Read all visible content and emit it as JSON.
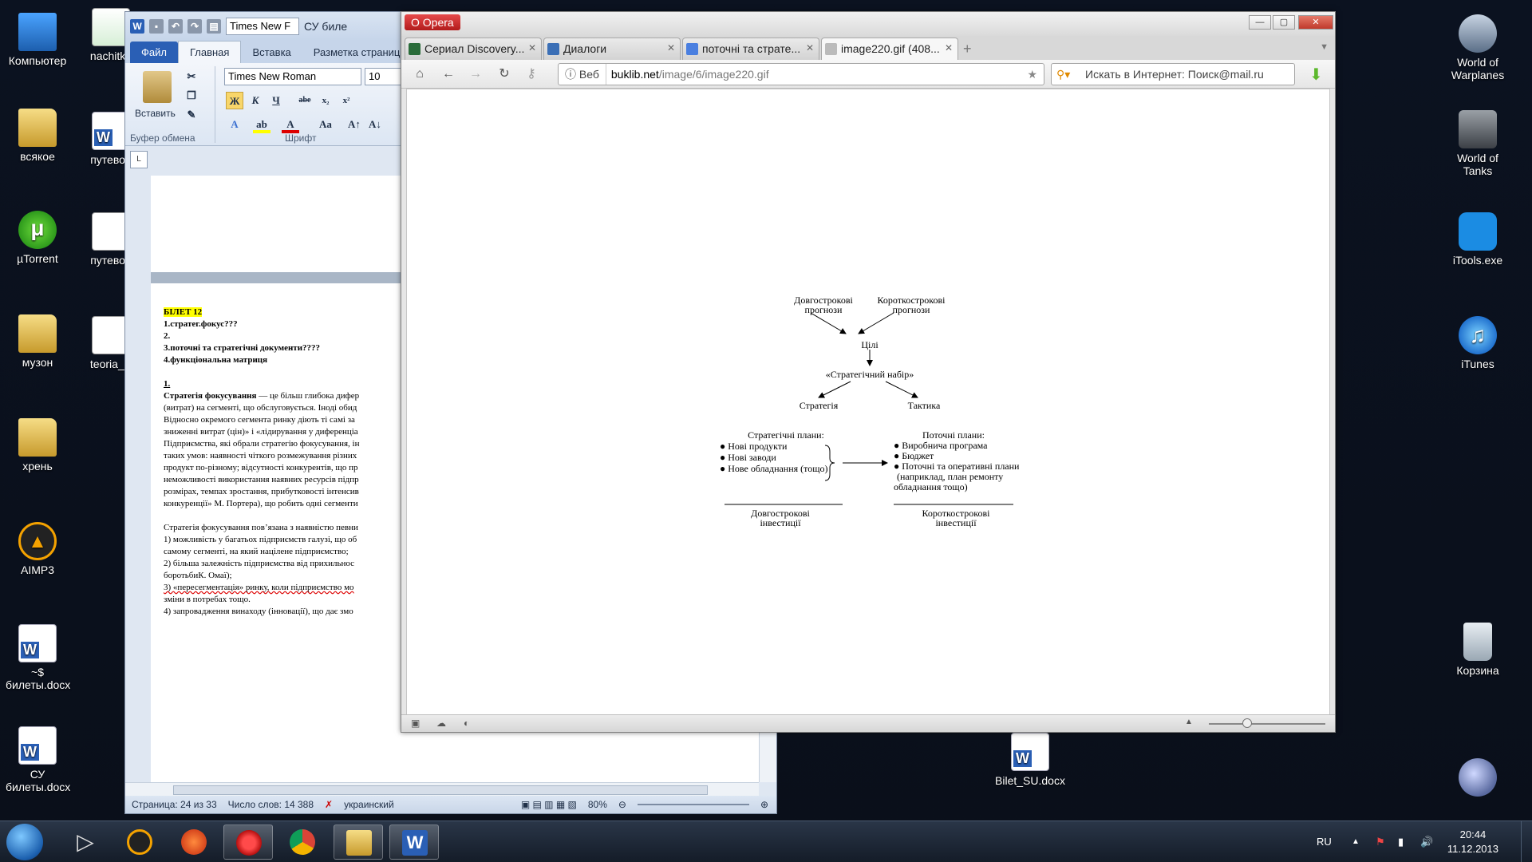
{
  "desktop": {
    "left_icons": [
      "Компьютер",
      "всякое",
      "µTorrent",
      "музон",
      "хрень",
      "AIMP3",
      "~$ билеты.docx",
      "СУ билеты.docx"
    ],
    "col2_icons": [
      "nachitka",
      "путевод",
      "путевод",
      "teoria_S"
    ],
    "right_icons": [
      "World of Warplanes",
      "World of Tanks",
      "iTools.exe",
      "iTunes",
      "Корзина"
    ],
    "desktop_file": "Bilet_SU.docx"
  },
  "word": {
    "font_name": "Times New F",
    "title": "СУ биле",
    "tabs": [
      "Файл",
      "Главная",
      "Вставка",
      "Разметка страниц"
    ],
    "ribbon": {
      "paste_label": "Вставить",
      "font_name": "Times New Roman",
      "font_size": "10",
      "group_clipboard": "Буфер обмена",
      "group_font": "Шрифт",
      "bold": "Ж",
      "italic": "К",
      "underline": "Ч",
      "strike": "abe",
      "sub": "x₂",
      "sup": "x²",
      "case": "Aa"
    },
    "doc": {
      "heading": "БІЛЕТ 12",
      "q1": "1.стратег.фокус???",
      "q2": "2.",
      "q3": "3.поточні та  стратегічні  документи????",
      "q4": "4.функціональна матриця",
      "section": "1.",
      "p1_bold": "Стратегія фокусування",
      "p1_rest": " — це більш глибока дифер",
      "lines": [
        "(витрат) на сегменті, що обслуговується. Іноді обид",
        "Відносно окремого сегмента ринку  діють ті самі за",
        "зниженні витрат (цін)» і «лідирування у диференціа",
        "Підприємства, які обрали стратегію фокусування, ін",
        "таких умов: наявності чіткого розмежування різних",
        "продукт по-різному; відсутності конкурентів, що пр",
        "неможливості використання наявних ресурсів підпр",
        "розмірах, темпах зростання, прибутковості інтенсив",
        "конкуренції» М. Портера), що робить одні сегменти"
      ],
      "p2": "Стратегія фокусування пов’язана з наявністю певни",
      "p2_lines": [
        " 1) можливість у багатьох підприємств галузі, що об",
        "самому сегменті,  на який націлене підприємство;",
        " 2) більша залежність підприємства від прихильнос",
        "боротьбиК. Омаї);",
        " 3) «пересегментація» ринку, коли підприємство мо",
        "зміни в потребах тощо.",
        " 4) запровадження винаходу (інновації), що дає змо"
      ]
    },
    "status": {
      "page": "Страница: 24 из 33",
      "words": "Число слов: 14 388",
      "lang": "украинский",
      "zoom": "80%"
    }
  },
  "opera": {
    "app_name": "Opera",
    "tabs": [
      {
        "label": "Сериал Discovery...",
        "active": false
      },
      {
        "label": "Диалоги",
        "active": false
      },
      {
        "label": "поточні та страте...",
        "active": false
      },
      {
        "label": "image220.gif (408...",
        "active": true
      }
    ],
    "address": {
      "web_label": "Веб",
      "host": "buklib.net",
      "path": "/image/6/image220.gif"
    },
    "search_placeholder": "Искать в Интернет: Поиск@mail.ru"
  },
  "diagram": {
    "long_forecasts": "Довгострокові прогнози",
    "short_forecasts": "Короткострокові прогнози",
    "goals": "Цілі",
    "strategic_set": "«Стратегічний набір»",
    "strategy": "Стратегія",
    "tactics": "Тактика",
    "strategic_plans_title": "Стратегічні плани:",
    "strategic_plans": [
      "● Нові продукти",
      "● Нові заводи",
      "● Нове обладнання (тощо)"
    ],
    "current_plans_title": "Поточні плани:",
    "current_plans": [
      "● Виробнича програма",
      "● Бюджет",
      "● Поточні та оперативні плани",
      "(наприклад, план ремонту",
      "обладнання тощо)"
    ],
    "long_investments": "Довгострокові інвестиції",
    "short_investments": "Короткострокові інвестиції"
  },
  "taskbar": {
    "lang": "RU",
    "time": "20:44",
    "date": "11.12.2013"
  }
}
